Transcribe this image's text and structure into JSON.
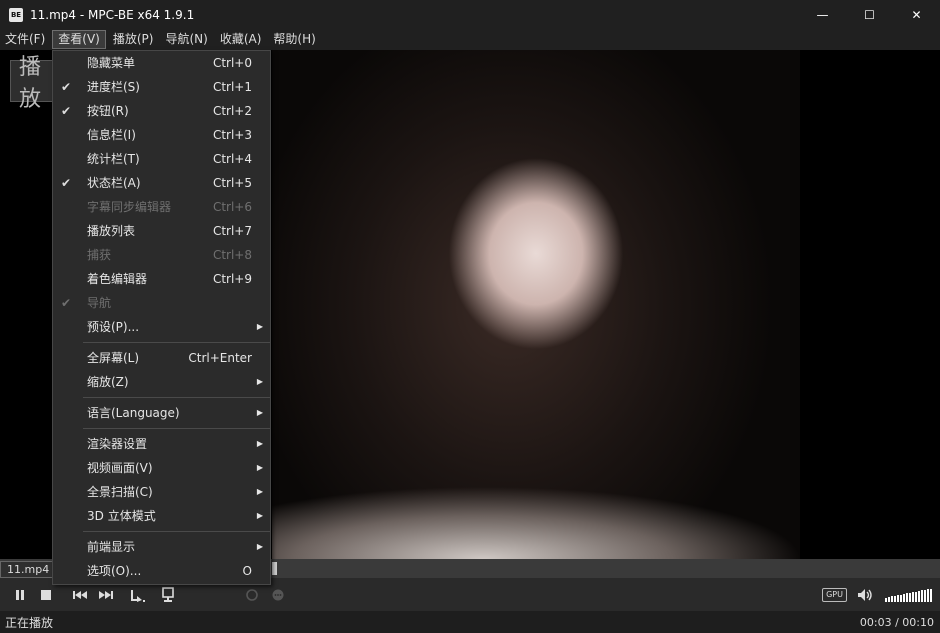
{
  "window": {
    "title": "11.mp4 - MPC-BE x64 1.9.1",
    "app_icon_text": "BE",
    "controls": {
      "minimize": "—",
      "maximize": "☐",
      "close": "✕"
    }
  },
  "menubar": [
    {
      "label": "文件(F)",
      "active": false
    },
    {
      "label": "查看(V)",
      "active": true
    },
    {
      "label": "播放(P)",
      "active": false
    },
    {
      "label": "导航(N)",
      "active": false
    },
    {
      "label": "收藏(A)",
      "active": false
    },
    {
      "label": "帮助(H)",
      "active": false
    }
  ],
  "osd": {
    "text": "播放"
  },
  "view_menu": {
    "groups": [
      [
        {
          "label": "隐藏菜单",
          "shortcut": "Ctrl+0",
          "checked": false,
          "disabled": false,
          "submenu": false
        },
        {
          "label": "进度栏(S)",
          "shortcut": "Ctrl+1",
          "checked": true,
          "disabled": false,
          "submenu": false
        },
        {
          "label": "按钮(R)",
          "shortcut": "Ctrl+2",
          "checked": true,
          "disabled": false,
          "submenu": false
        },
        {
          "label": "信息栏(I)",
          "shortcut": "Ctrl+3",
          "checked": false,
          "disabled": false,
          "submenu": false
        },
        {
          "label": "统计栏(T)",
          "shortcut": "Ctrl+4",
          "checked": false,
          "disabled": false,
          "submenu": false
        },
        {
          "label": "状态栏(A)",
          "shortcut": "Ctrl+5",
          "checked": true,
          "disabled": false,
          "submenu": false
        },
        {
          "label": "字幕同步编辑器",
          "shortcut": "Ctrl+6",
          "checked": false,
          "disabled": true,
          "submenu": false
        },
        {
          "label": "播放列表",
          "shortcut": "Ctrl+7",
          "checked": false,
          "disabled": false,
          "submenu": false
        },
        {
          "label": "捕获",
          "shortcut": "Ctrl+8",
          "checked": false,
          "disabled": true,
          "submenu": false
        },
        {
          "label": "着色编辑器",
          "shortcut": "Ctrl+9",
          "checked": false,
          "disabled": false,
          "submenu": false
        },
        {
          "label": "导航",
          "shortcut": "",
          "checked": true,
          "disabled": true,
          "submenu": false
        },
        {
          "label": "预设(P)...",
          "shortcut": "",
          "checked": false,
          "disabled": false,
          "submenu": true
        }
      ],
      [
        {
          "label": "全屏幕(L)",
          "shortcut": "Ctrl+Enter",
          "checked": false,
          "disabled": false,
          "submenu": false
        },
        {
          "label": "缩放(Z)",
          "shortcut": "",
          "checked": false,
          "disabled": false,
          "submenu": true
        }
      ],
      [
        {
          "label": "语言(Language)",
          "shortcut": "",
          "checked": false,
          "disabled": false,
          "submenu": true
        }
      ],
      [
        {
          "label": "渲染器设置",
          "shortcut": "",
          "checked": false,
          "disabled": false,
          "submenu": true
        },
        {
          "label": "视频画面(V)",
          "shortcut": "",
          "checked": false,
          "disabled": false,
          "submenu": true
        },
        {
          "label": "全景扫描(C)",
          "shortcut": "",
          "checked": false,
          "disabled": false,
          "submenu": true
        },
        {
          "label": "3D 立体模式",
          "shortcut": "",
          "checked": false,
          "disabled": false,
          "submenu": true
        }
      ],
      [
        {
          "label": "前端显示",
          "shortcut": "",
          "checked": false,
          "disabled": false,
          "submenu": true
        },
        {
          "label": "选项(O)...",
          "shortcut": "O",
          "checked": false,
          "disabled": false,
          "submenu": false
        }
      ]
    ]
  },
  "seekbar": {
    "file_label": "11.mp4",
    "progress": 0.3
  },
  "toolbar": {
    "gpu_label": "GPU",
    "volume_level": 1.0
  },
  "status": {
    "state": "正在播放",
    "time": "00:03 / 00:10"
  }
}
